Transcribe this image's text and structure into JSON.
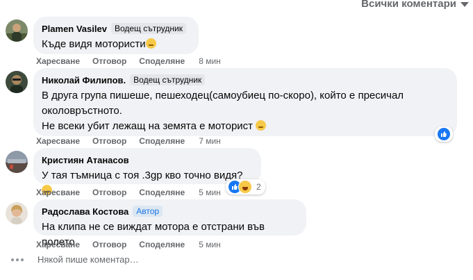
{
  "header": {
    "sort_label": "Всички коментари"
  },
  "comments": [
    {
      "author": "Plamen Vasilev",
      "badge": "Водещ сътрудник",
      "lines": [
        "Къде видя мотористи"
      ],
      "actions": {
        "like": "Харесване",
        "reply": "Отговор",
        "share": "Споделяне",
        "time": "8 мин"
      }
    },
    {
      "author": "Николай Филипов.",
      "badge": "Водещ сътрудник",
      "lines": [
        "В друга група пишеше, пешеходец(самоубиец по-скоро), който е пресичал",
        "околовръстното.",
        "Не всеки убит лежащ на земята е моторист"
      ],
      "actions": {
        "like": "Харесване",
        "reply": "Отговор",
        "share": "Споделяне",
        "time": "7 мин"
      }
    },
    {
      "author": "Кристиян Атанасов",
      "badge": "",
      "lines": [
        "У тая тъмница с тоя .3gp кво точно видя?"
      ],
      "reaction_count": "2",
      "actions": {
        "like": "Харесване",
        "reply": "Отговор",
        "share": "Споделяне",
        "time": "5 мин"
      }
    },
    {
      "author": "Радослава Костова",
      "badge": "Автор",
      "lines": [
        "На клипа не се виждат мотора е отстрани във полето"
      ],
      "actions": {
        "like": "Харесване",
        "reply": "Отговор",
        "share": "Споделяне",
        "time": "5 мин"
      }
    }
  ],
  "typing": {
    "text": "Някой пише коментар…"
  },
  "colors": {
    "bubble": "#f0f2f5",
    "secondary_text": "#65676b",
    "like_blue": "#1877f2",
    "author_badge": "#1b74e4"
  }
}
